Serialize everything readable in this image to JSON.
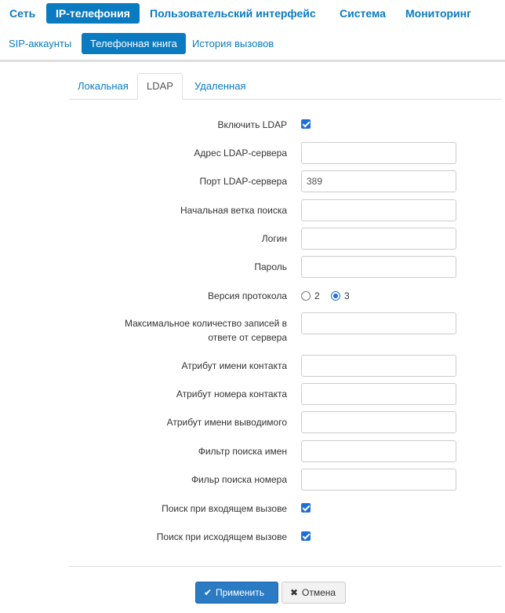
{
  "topnav": {
    "items": [
      {
        "label": "Сеть"
      },
      {
        "label": "IP-телефония",
        "active": true
      },
      {
        "label": "Пользовательский интерфейс"
      },
      {
        "label": "Система"
      },
      {
        "label": "Мониторинг"
      }
    ]
  },
  "subnav": {
    "items": [
      {
        "label": "SIP-аккаунты"
      },
      {
        "label": "Телефонная книга",
        "active": true
      },
      {
        "label": "История вызовов"
      }
    ]
  },
  "tabs": [
    {
      "label": "Локальная"
    },
    {
      "label": "LDAP",
      "active": true
    },
    {
      "label": "Удаленная"
    }
  ],
  "form": {
    "enable_ldap": {
      "label": "Включить LDAP",
      "checked": true
    },
    "server_address": {
      "label": "Адрес LDAP-сервера",
      "value": ""
    },
    "server_port": {
      "label": "Порт LDAP-сервера",
      "value": "389"
    },
    "search_base": {
      "label": "Начальная ветка поиска",
      "value": ""
    },
    "login": {
      "label": "Логин",
      "value": ""
    },
    "password": {
      "label": "Пароль",
      "value": ""
    },
    "protocol_version": {
      "label": "Версия протокола",
      "options": [
        {
          "label": "2",
          "selected": false
        },
        {
          "label": "3",
          "selected": true
        }
      ]
    },
    "max_records": {
      "label": "Максимальное количество записей в ответе от сервера",
      "value": ""
    },
    "contact_name_attr": {
      "label": "Атрибут имени контакта",
      "value": ""
    },
    "contact_number_attr": {
      "label": "Атрибут номера контакта",
      "value": ""
    },
    "display_name_attr": {
      "label": "Атрибут имени выводимого",
      "value": ""
    },
    "name_filter": {
      "label": "Фильтр поиска имен",
      "value": ""
    },
    "number_filter": {
      "label": "Фильр поиска номера",
      "value": ""
    },
    "search_incoming": {
      "label": "Поиск при входящем вызове",
      "checked": true
    },
    "search_outgoing": {
      "label": "Поиск при исходящем вызове",
      "checked": true
    }
  },
  "buttons": {
    "apply": {
      "label": "Применить",
      "icon": "check-icon"
    },
    "cancel": {
      "label": "Отмена",
      "icon": "close-icon"
    }
  },
  "colors": {
    "accent": "#0b7bc1",
    "checkbox": "#1e6fd9",
    "apply_button": "#2a7bc4"
  }
}
